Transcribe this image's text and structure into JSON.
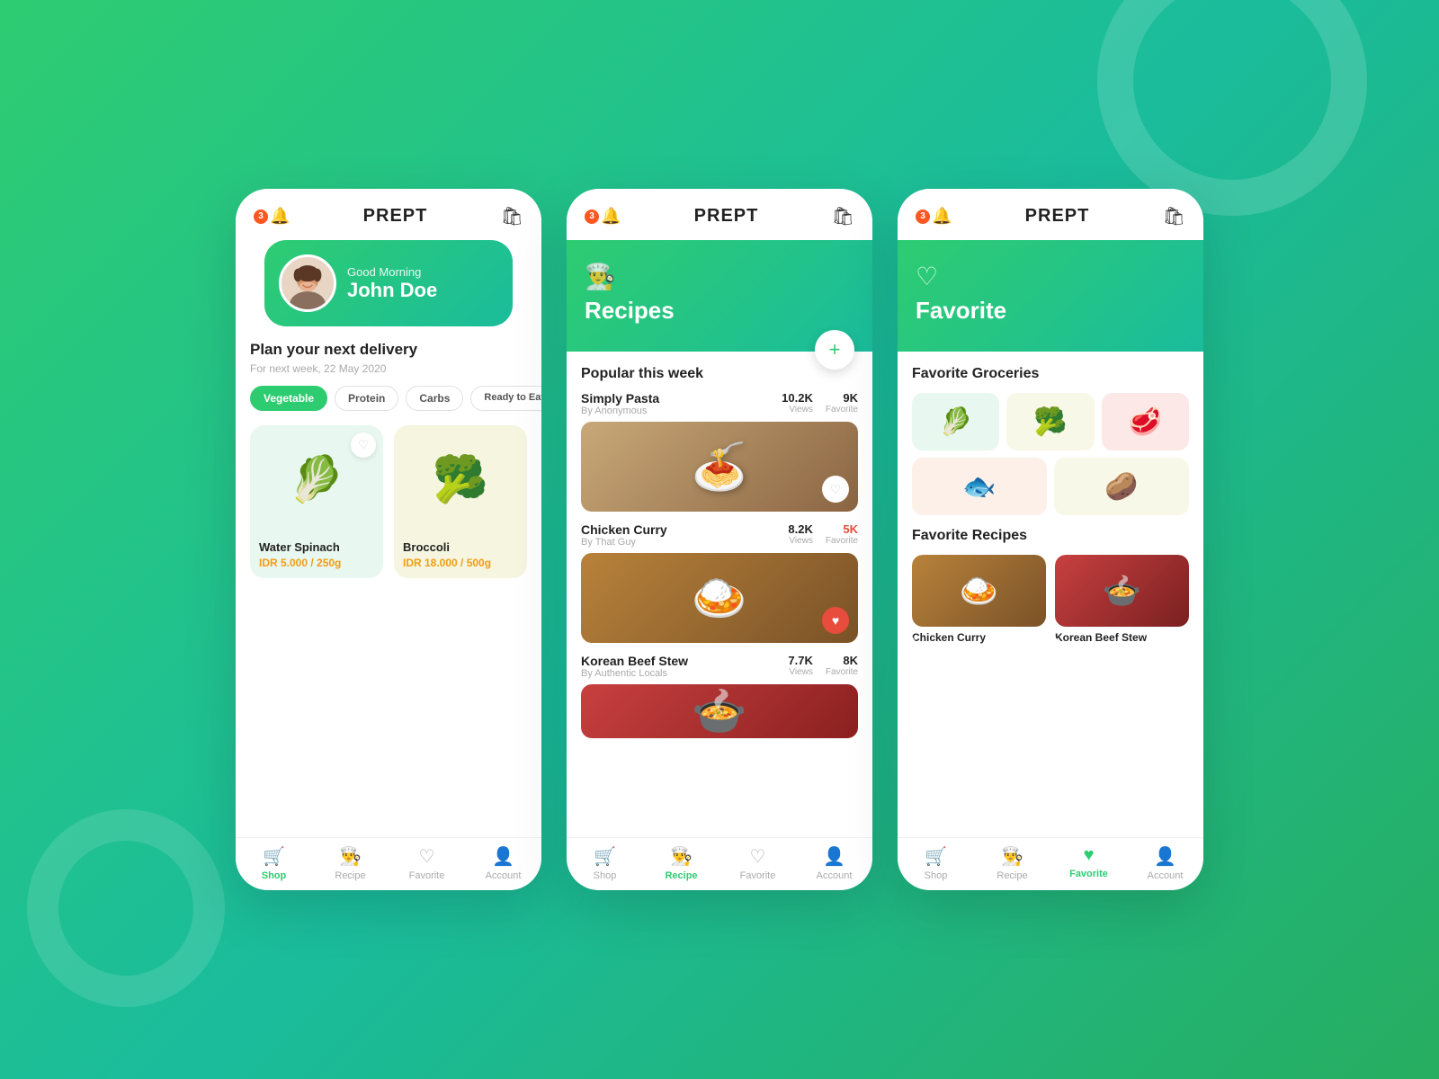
{
  "app": {
    "name": "PREPT",
    "notification_count": "3"
  },
  "screens": [
    {
      "id": "screen-shop",
      "header": {
        "title": "PREPT",
        "notif": "3"
      },
      "hero": {
        "greeting": "Good Morning",
        "username": "John Doe"
      },
      "delivery": {
        "title": "Plan your next delivery",
        "subtitle": "For next week, 22 May 2020"
      },
      "filters": [
        "Vegetable",
        "Protein",
        "Carbs",
        "Ready to Eat"
      ],
      "active_filter": "Vegetable",
      "products": [
        {
          "name": "Water Spinach",
          "price": "IDR 5.000",
          "unit": "/ 250g",
          "emoji": "🥬",
          "bg": "green"
        },
        {
          "name": "Broccoli",
          "price": "IDR 18.000",
          "unit": "/ 500g",
          "emoji": "🥦",
          "bg": "yellow"
        }
      ],
      "nav": {
        "items": [
          {
            "label": "Shop",
            "active": true,
            "icon": "🛒"
          },
          {
            "label": "Recipe",
            "active": false,
            "icon": "👨‍🍳"
          },
          {
            "label": "Favorite",
            "active": false,
            "icon": "♡"
          },
          {
            "label": "Account",
            "active": false,
            "icon": "👤"
          }
        ]
      }
    },
    {
      "id": "screen-recipe",
      "header": {
        "title": "PREPT",
        "notif": "3"
      },
      "hero": {
        "icon": "👨‍🍳",
        "title": "Recipes"
      },
      "popular_title": "Popular this week",
      "recipes": [
        {
          "name": "Simply Pasta",
          "author": "By Anonymous",
          "views": "10.2K",
          "favorite": "9K",
          "favorite_hot": false,
          "emoji": "🍝",
          "liked": false
        },
        {
          "name": "Chicken Curry",
          "author": "By That Guy",
          "views": "8.2K",
          "favorite": "5K",
          "favorite_hot": true,
          "emoji": "🍛",
          "liked": true
        },
        {
          "name": "Korean Beef Stew",
          "author": "By Authentic Locals",
          "views": "7.7K",
          "favorite": "8K",
          "favorite_hot": false,
          "emoji": "🍲",
          "liked": false
        }
      ],
      "nav": {
        "items": [
          {
            "label": "Shop",
            "active": false,
            "icon": "🛒"
          },
          {
            "label": "Recipe",
            "active": true,
            "icon": "👨‍🍳"
          },
          {
            "label": "Favorite",
            "active": false,
            "icon": "♡"
          },
          {
            "label": "Account",
            "active": false,
            "icon": "👤"
          }
        ]
      }
    },
    {
      "id": "screen-favorite",
      "header": {
        "title": "PREPT",
        "notif": "3"
      },
      "hero": {
        "icon": "♡",
        "title": "Favorite"
      },
      "groceries_title": "Favorite Groceries",
      "groceries": [
        {
          "emoji": "🥬",
          "bg": "green"
        },
        {
          "emoji": "🥦",
          "bg": "yellow"
        },
        {
          "emoji": "🥩",
          "bg": "pink"
        },
        {
          "emoji": "🐟",
          "bg": "orange"
        },
        {
          "emoji": "🥔",
          "bg": "yellow"
        }
      ],
      "fav_recipes_title": "Favorite Recipes",
      "fav_recipes": [
        {
          "name": "Chicken Curry",
          "emoji": "🍛"
        },
        {
          "name": "Korean Beef Stew",
          "emoji": "🍲"
        }
      ],
      "nav": {
        "items": [
          {
            "label": "Shop",
            "active": false,
            "icon": "🛒"
          },
          {
            "label": "Recipe",
            "active": false,
            "icon": "👨‍🍳"
          },
          {
            "label": "Favorite",
            "active": true,
            "icon": "♡"
          },
          {
            "label": "Account",
            "active": false,
            "icon": "👤"
          }
        ]
      }
    }
  ]
}
